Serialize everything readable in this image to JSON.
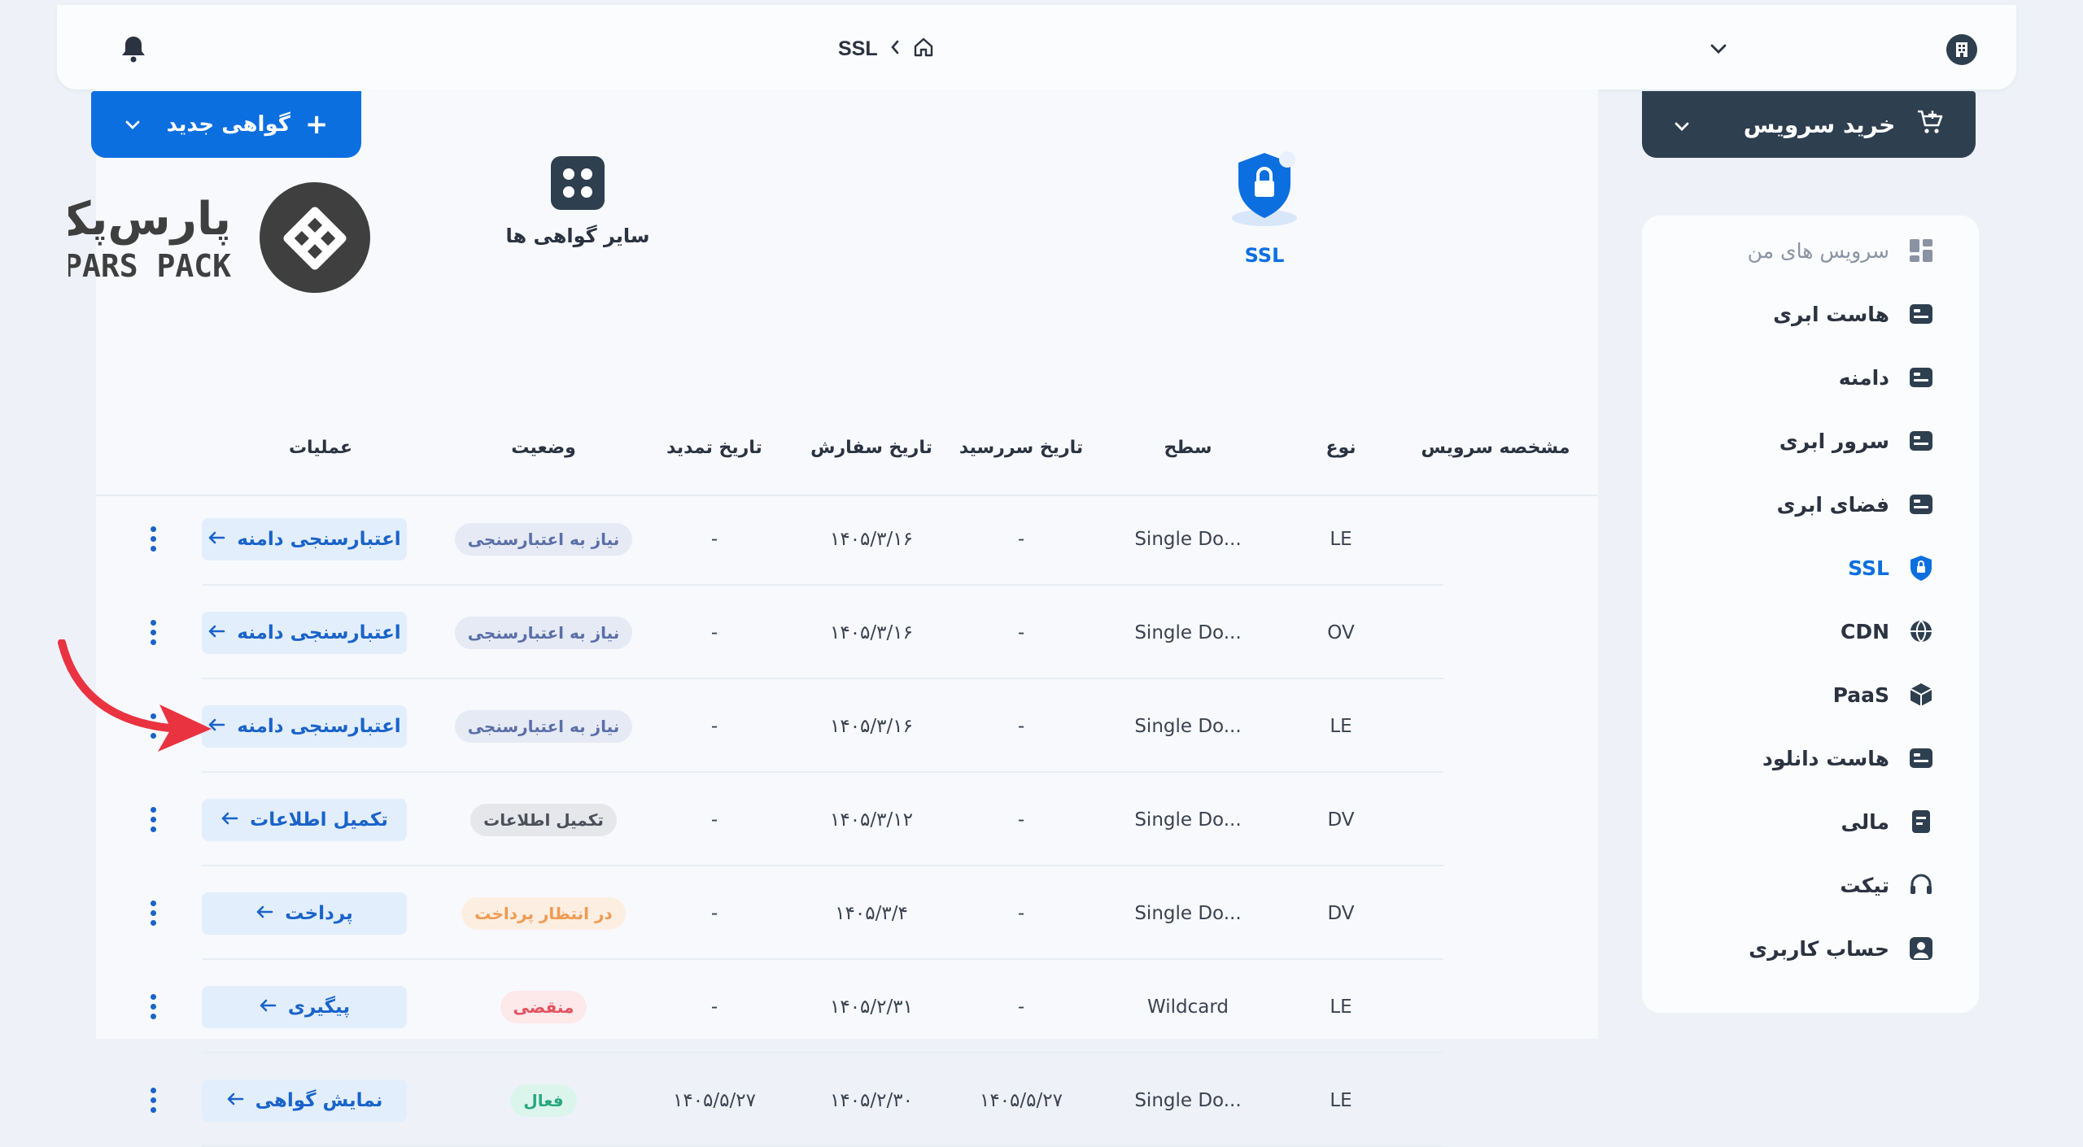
{
  "topbar": {
    "breadcrumb_current": "SSL",
    "icons": [
      "bell-icon",
      "home-icon",
      "chevron-left-icon",
      "chevron-down-icon",
      "building-icon"
    ]
  },
  "actions": {
    "new_certificate": "گواهی جدید",
    "buy_service": "خرید سرویس"
  },
  "tabs": [
    {
      "label": "SSL",
      "active": true
    },
    {
      "label": "سایر گواهی ها",
      "active": false
    }
  ],
  "logo": {
    "fa": "پارس‌پک",
    "en": "PARS PACK"
  },
  "table": {
    "headers": {
      "service_id": "مشخصه سرویس",
      "type": "نوع",
      "level": "سطح",
      "due_date": "تاریخ سررسید",
      "order_date": "تاریخ سفارش",
      "renew_date": "تاریخ تمدید",
      "status": "وضعیت",
      "operations": "عملیات"
    },
    "rows": [
      {
        "type": "LE",
        "level": "Single Do...",
        "due": "-",
        "order": "۱۴۰۵/۳/۱۶",
        "renew": "-",
        "status": "نیاز به اعتبارسنجی",
        "status_kind": "need",
        "action": "اعتبارسنجی دامنه"
      },
      {
        "type": "OV",
        "level": "Single Do...",
        "due": "-",
        "order": "۱۴۰۵/۳/۱۶",
        "renew": "-",
        "status": "نیاز به اعتبارسنجی",
        "status_kind": "need",
        "action": "اعتبارسنجی دامنه"
      },
      {
        "type": "LE",
        "level": "Single Do...",
        "due": "-",
        "order": "۱۴۰۵/۳/۱۶",
        "renew": "-",
        "status": "نیاز به اعتبارسنجی",
        "status_kind": "need",
        "action": "اعتبارسنجی دامنه"
      },
      {
        "type": "DV",
        "level": "Single Do...",
        "due": "-",
        "order": "۱۴۰۵/۳/۱۲",
        "renew": "-",
        "status": "تکمیل اطلاعات",
        "status_kind": "complete",
        "action": "تکمیل اطلاعات"
      },
      {
        "type": "DV",
        "level": "Single Do...",
        "due": "-",
        "order": "۱۴۰۵/۳/۴",
        "renew": "-",
        "status": "در انتظار پرداخت",
        "status_kind": "wait",
        "action": "پرداخت"
      },
      {
        "type": "LE",
        "level": "Wildcard",
        "due": "-",
        "order": "۱۴۰۵/۲/۳۱",
        "renew": "-",
        "status": "منقضی",
        "status_kind": "expired",
        "action": "پیگیری"
      },
      {
        "type": "LE",
        "level": "Single Do...",
        "due": "۱۴۰۵/۵/۲۷",
        "order": "۱۴۰۵/۲/۳۰",
        "renew": "۱۴۰۵/۵/۲۷",
        "status": "فعال",
        "status_kind": "active",
        "action": "نمایش گواهی"
      }
    ]
  },
  "sidebar": {
    "items": [
      {
        "label": "سرویس های من",
        "icon": "grid-icon",
        "state": "dim"
      },
      {
        "label": "هاست ابری",
        "icon": "cloud-host-icon",
        "state": "normal"
      },
      {
        "label": "دامنه",
        "icon": "domain-icon",
        "state": "normal"
      },
      {
        "label": "سرور ابری",
        "icon": "server-icon",
        "state": "normal"
      },
      {
        "label": "فضای ابری",
        "icon": "cloud-storage-icon",
        "state": "normal"
      },
      {
        "label": "SSL",
        "icon": "shield-lock-icon",
        "state": "active"
      },
      {
        "label": "CDN",
        "icon": "globe-icon",
        "state": "normal"
      },
      {
        "label": "PaaS",
        "icon": "cube-icon",
        "state": "normal"
      },
      {
        "label": "هاست دانلود",
        "icon": "download-host-icon",
        "state": "normal"
      },
      {
        "label": "مالی",
        "icon": "wallet-icon",
        "state": "normal"
      },
      {
        "label": "تیکت",
        "icon": "headset-icon",
        "state": "normal"
      },
      {
        "label": "حساب کاربری",
        "icon": "user-icon",
        "state": "normal"
      }
    ]
  },
  "colors": {
    "primary": "#0c6fe0",
    "dark_button": "#2e3f4f",
    "annotation_arrow": "#ea3340"
  }
}
